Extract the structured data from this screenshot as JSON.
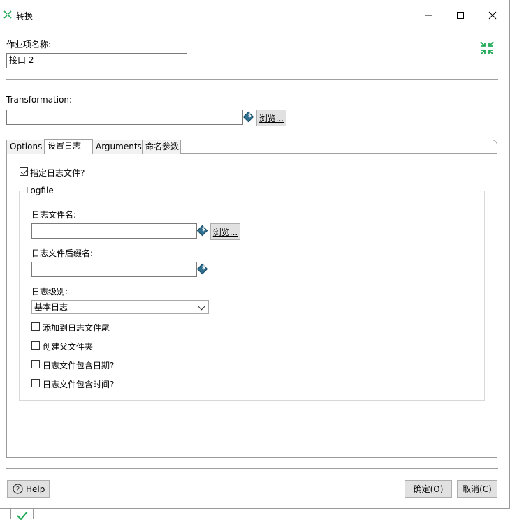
{
  "window": {
    "title": "转换"
  },
  "job": {
    "name_label": "作业项名称:",
    "name_value": "接口 2"
  },
  "transformation": {
    "label": "Transformation:",
    "value": "",
    "browse_label": "浏览..."
  },
  "tabs": [
    {
      "label": "Options"
    },
    {
      "label": "设置日志"
    },
    {
      "label": "Arguments"
    },
    {
      "label": "命名参数"
    }
  ],
  "log": {
    "specify_label": "指定日志文件?",
    "specify_checked": true,
    "group_title": "Logfile",
    "filename_label": "日志文件名:",
    "filename_value": "",
    "browse_label": "浏览...",
    "suffix_label": "日志文件后缀名:",
    "suffix_value": "",
    "level_label": "日志级别:",
    "level_value": "基本日志",
    "options": [
      {
        "label": "添加到日志文件尾"
      },
      {
        "label": "创建父文件夹"
      },
      {
        "label": "日志文件包含日期?"
      },
      {
        "label": "日志文件包含时间?"
      }
    ]
  },
  "footer": {
    "help_label": "Help",
    "ok_label": "确定(O)",
    "cancel_label": "取消(C)"
  },
  "colors": {
    "accent_green": "#1fa855",
    "var_icon": "#2f6f8f"
  }
}
